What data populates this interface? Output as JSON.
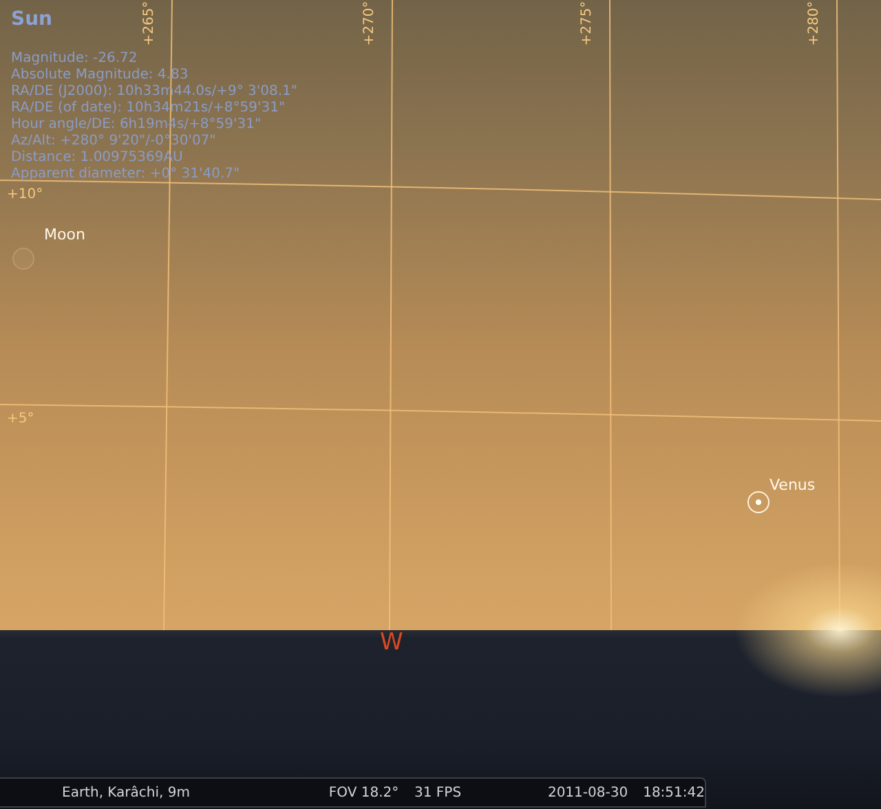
{
  "object_info": {
    "title": "Sun",
    "lines": [
      "Magnitude: -26.72",
      "Absolute Magnitude: 4.83",
      "RA/DE (J2000): 10h33m44.0s/+9° 3'08.1\"",
      "RA/DE (of date): 10h34m21s/+8°59'31\"",
      "Hour angle/DE: 6h19m4s/+8°59'31\"",
      "Az/Alt: +280° 9'20\"/-0°30'07\"",
      "Distance: 1.00975369AU",
      "Apparent diameter: +0° 31'40.7\""
    ]
  },
  "grid": {
    "meridians": [
      {
        "label": "+265°"
      },
      {
        "label": "+270°"
      },
      {
        "label": "+275°"
      },
      {
        "label": "+280°"
      }
    ],
    "parallels": [
      {
        "label": "+10°"
      },
      {
        "label": "+5°"
      }
    ]
  },
  "objects": [
    {
      "name": "Moon",
      "kind": "moon"
    },
    {
      "name": "Venus",
      "kind": "planet"
    }
  ],
  "compass": {
    "label": "W"
  },
  "status_bar": {
    "location": "Earth, Karâchi, 9m",
    "fov": "FOV 18.2°",
    "fps": "31 FPS",
    "date": "2011-08-30",
    "time": "18:51:42"
  }
}
